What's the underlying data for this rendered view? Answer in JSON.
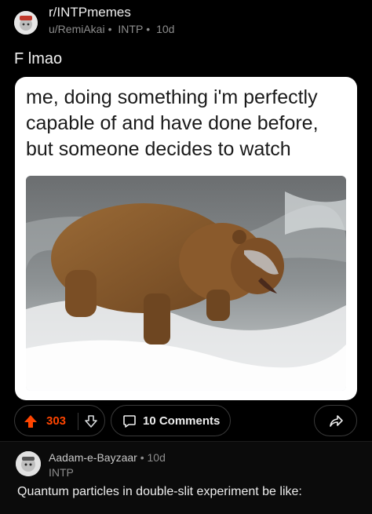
{
  "post": {
    "subreddit": "r/INTPmemes",
    "author": "u/RemiAkai",
    "flair": "INTP",
    "separator": "•",
    "age": "10d",
    "title": "F lmao",
    "meme_caption": "me, doing something i'm perfectly capable of and have done before, but someone decides to watch",
    "image_description_icon": "bear-catching-salmon-photo"
  },
  "actions": {
    "vote_count": "303",
    "comments_label": "10 Comments",
    "upvote_color": "#ff4500"
  },
  "comment": {
    "author": "Aadam-e-Bayzaar",
    "separator": "•",
    "age": "10d",
    "flair": "INTP",
    "body": "Quantum particles in double-slit experiment be like:"
  },
  "colors": {
    "background": "#000000",
    "accent": "#ff4500",
    "card": "#ffffff"
  }
}
